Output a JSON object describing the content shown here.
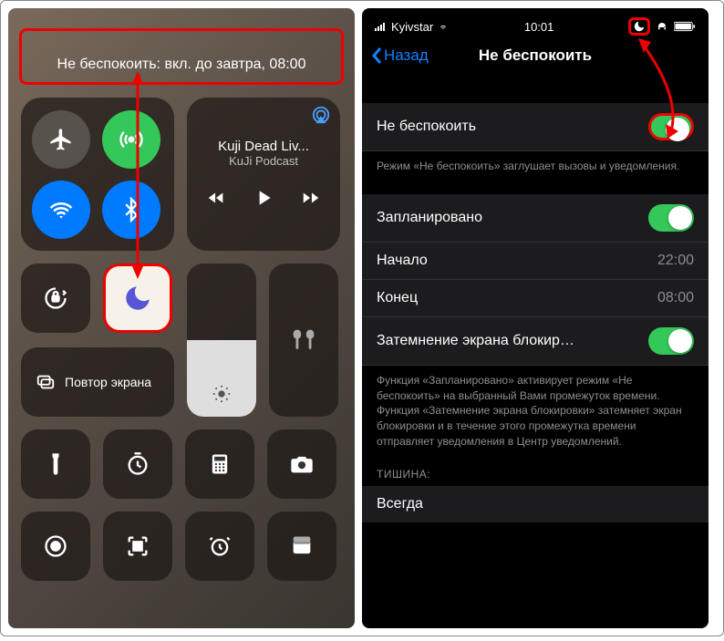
{
  "left": {
    "status": "Не беспокоить: вкл. до завтра, 08:00",
    "media": {
      "title": "Kuji Dead Liv...",
      "subtitle": "KuJi Podcast"
    },
    "screen_mirror": "Повтор экрана"
  },
  "right": {
    "statusbar": {
      "carrier": "Kyivstar",
      "time": "10:01"
    },
    "nav": {
      "back": "Назад",
      "title": "Не беспокоить"
    },
    "main_toggle": {
      "label": "Не беспокоить"
    },
    "main_footer": "Режим «Не беспокоить» заглушает вызовы и уведомления.",
    "scheduled": {
      "label": "Запланировано"
    },
    "from": {
      "label": "Начало",
      "value": "22:00"
    },
    "to": {
      "label": "Конец",
      "value": "08:00"
    },
    "dim": {
      "label": "Затемнение экрана блокир…"
    },
    "sched_footer": "Функция «Запланировано» активирует режим «Не беспокоить» на выбранный Вами промежуток времени. Функция «Затемнение экрана блокировки» затемняет экран блокировки и в течение этого промежутка времени отправляет уведомления в Центр уведомлений.",
    "silence_header": "ТИШИНА:",
    "always": "Всегда"
  }
}
